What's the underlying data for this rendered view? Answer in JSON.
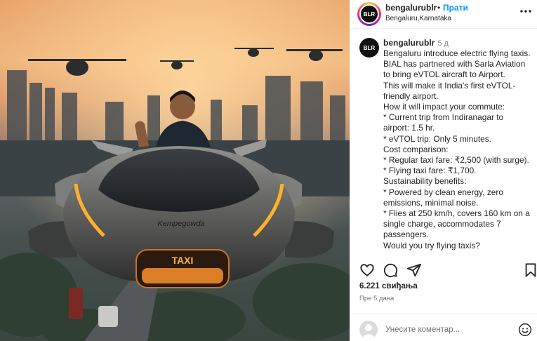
{
  "header": {
    "avatar_text": "BLR",
    "username": "bengalurublr",
    "separator": "•",
    "follow_label": "Прати",
    "location": "Bengaluru,Karnataka",
    "more_icon": "more-horizontal-icon"
  },
  "media": {
    "vehicle_brand_text": "Kempegowda",
    "taxi_sign": "TAXI"
  },
  "caption": {
    "avatar_text": "BLR",
    "username": "bengalurublr",
    "time": "5 д",
    "lines": [
      "Bengaluru introduce electric flying taxis.",
      "BIAL has partnered with Sarla Aviation",
      "to bring eVTOL aircraft to Airport.",
      "This will make it India's first eVTOL-",
      "friendly airport.",
      "How it will impact your commute:",
      "* Current trip from Indiranagar to",
      "airport: 1.5 hr.",
      "* eVTOL trip: Only 5 minutes.",
      "Cost comparison:",
      "* Regular taxi fare: ₹2,500 (with surge).",
      "* Flying taxi fare: ₹1,700.",
      "Sustainability benefits:",
      "* Powered by clean energy, zero",
      "emissions, minimal noise.",
      "* Flies at 250 km/h, covers 160 km on a",
      "single charge, accommodates 7",
      "passengers.",
      "Would you try flying taxis?"
    ]
  },
  "actions": {
    "like_icon": "heart-icon",
    "comment_icon": "comment-icon",
    "share_icon": "share-icon",
    "save_icon": "bookmark-icon"
  },
  "likes": "6.221 свиђања",
  "posted_ago": "Пре 5 дана",
  "comment_box": {
    "placeholder": "Унесите коментар...",
    "emoji_icon": "emoji-icon"
  }
}
